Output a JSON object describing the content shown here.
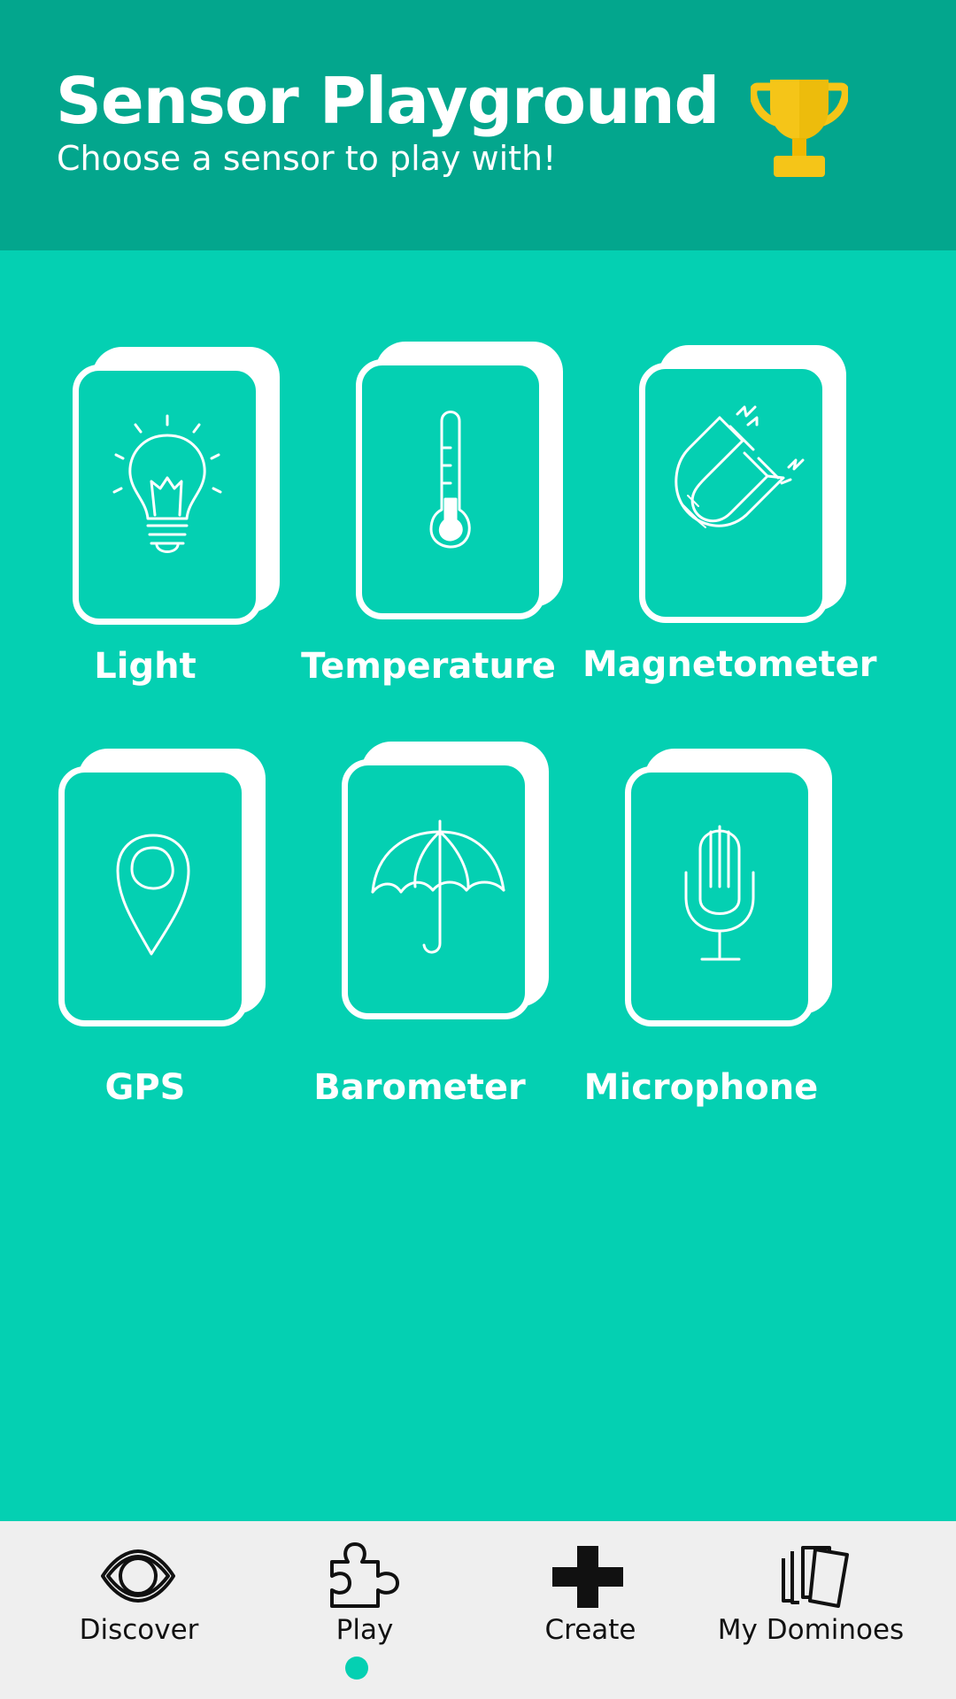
{
  "header": {
    "title": "Sensor Playground",
    "subtitle": "Choose a sensor to play with!",
    "trophy_icon": "trophy-icon"
  },
  "sensors": [
    {
      "label": "Light",
      "icon": "lightbulb-icon"
    },
    {
      "label": "Temperature",
      "icon": "thermometer-icon"
    },
    {
      "label": "Magnetometer",
      "icon": "magnet-icon"
    },
    {
      "label": "GPS",
      "icon": "location-pin-icon"
    },
    {
      "label": "Barometer",
      "icon": "umbrella-icon"
    },
    {
      "label": "Microphone",
      "icon": "microphone-icon"
    }
  ],
  "tabbar": {
    "active": "Play",
    "tabs": [
      {
        "label": "Discover",
        "icon": "eye-icon"
      },
      {
        "label": "Play",
        "icon": "puzzle-icon"
      },
      {
        "label": "Create",
        "icon": "plus-icon"
      },
      {
        "label": "My Dominoes",
        "icon": "cards-icon"
      }
    ]
  },
  "colors": {
    "background": "#04d0b2",
    "header": "#03a68d",
    "trophy": "#f5c518",
    "tabbar": "#efefef"
  }
}
